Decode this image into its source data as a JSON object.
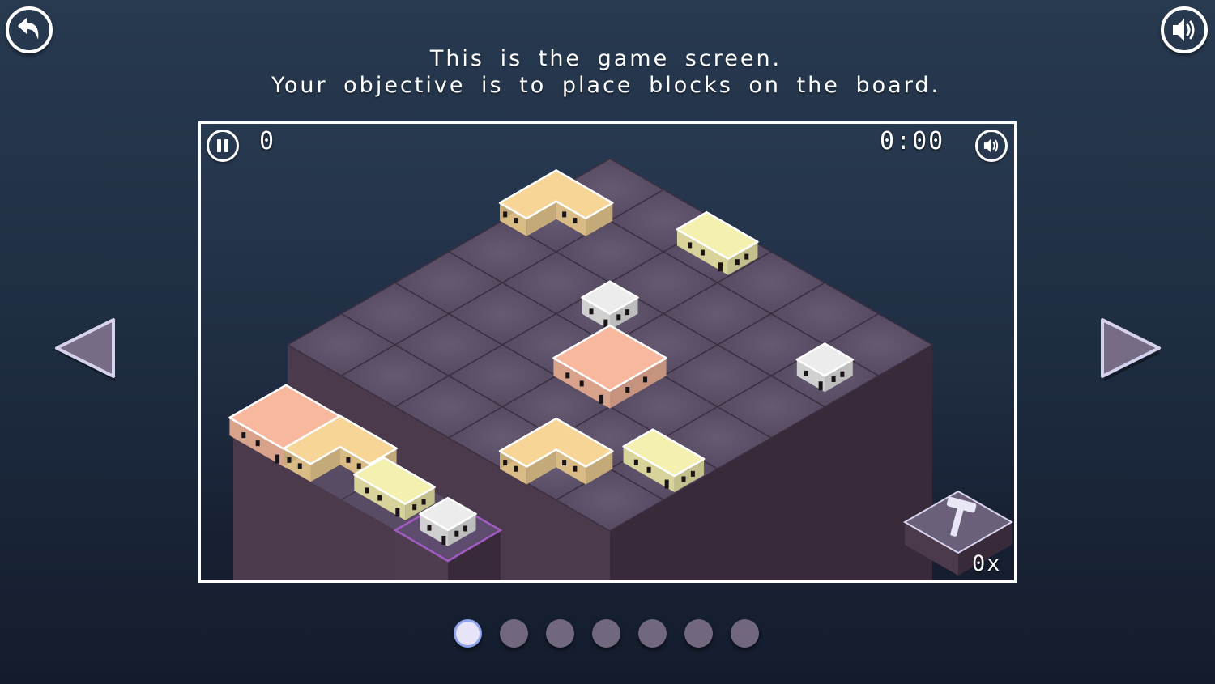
{
  "header": {
    "back_icon": "undo-arrow-icon",
    "sound_icon": "speaker-icon",
    "instructions": [
      "This is the game screen.",
      "Your objective is to place blocks on the board."
    ]
  },
  "game": {
    "score": "0",
    "timer": "0:00",
    "pause_icon": "pause-icon",
    "sound_icon": "speaker-icon",
    "hammer": {
      "icon": "hammer-icon",
      "count_label": "0x"
    },
    "board": {
      "rows": 6,
      "cols": 6,
      "placed_blocks": [
        {
          "type": "L",
          "color": "tan",
          "row": 1,
          "col": 0
        },
        {
          "type": "bar",
          "color": "yellow",
          "row": 0,
          "col": 2
        },
        {
          "type": "small",
          "color": "white",
          "row": 2,
          "col": 2
        },
        {
          "type": "big",
          "color": "peach",
          "row": 3,
          "col": 3
        },
        {
          "type": "small",
          "color": "white",
          "row": 1,
          "col": 5
        },
        {
          "type": "L",
          "color": "tan",
          "row": 5,
          "col": 4
        },
        {
          "type": "bar",
          "color": "yellow",
          "row": 4,
          "col": 5
        }
      ]
    },
    "tray": [
      {
        "type": "big",
        "color": "peach",
        "selected": false
      },
      {
        "type": "L",
        "color": "tan",
        "selected": false
      },
      {
        "type": "bar",
        "color": "yellow",
        "selected": false
      },
      {
        "type": "small",
        "color": "white",
        "selected": true
      }
    ],
    "colors": {
      "peach": "#f7b89e",
      "tan": "#f6d597",
      "yellow": "#f4f0b0",
      "white": "#ececec",
      "highlight": "#a35bc4",
      "tile": "#5b5067"
    }
  },
  "navigation": {
    "prev_icon": "triangle-left-icon",
    "next_icon": "triangle-right-icon",
    "pages": 7,
    "current_page": 1
  }
}
